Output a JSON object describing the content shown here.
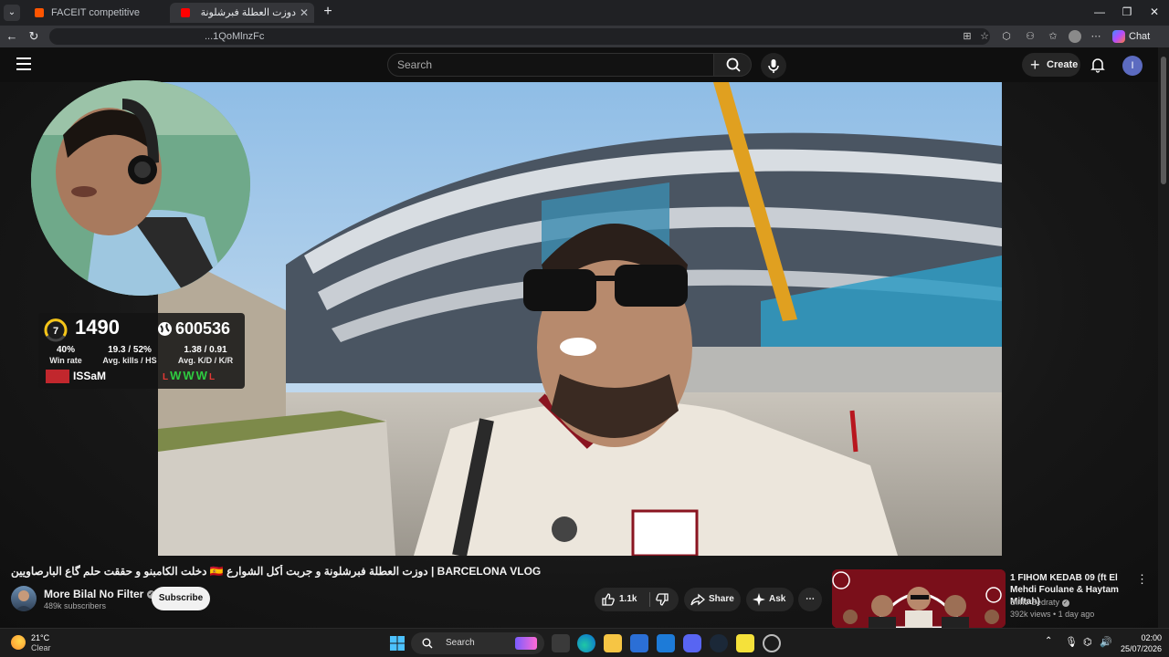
{
  "browser": {
    "tabs": [
      {
        "label": "FACEIT competitive"
      },
      {
        "label": "دوزت العطلة فبرشلونة و جربت أكل"
      }
    ],
    "url": "...1QoMlnzFc",
    "chat_label": "Chat"
  },
  "youtube": {
    "search_placeholder": "Search",
    "create_label": "Create",
    "account_initial": "I"
  },
  "faceit": {
    "level": "7",
    "elo": "1490",
    "matches": "600536",
    "stats": [
      {
        "value": "40%",
        "label": "Win rate"
      },
      {
        "value": "19.3 / 52%",
        "label": "Avg. kills / HS"
      },
      {
        "value": "1.38 / 0.91",
        "label": "Avg. K/D / K/R"
      }
    ],
    "nickname": "ISSaM",
    "results": [
      "L",
      "W",
      "W",
      "W",
      "L"
    ],
    "colors": {
      "win": "#2ecc40",
      "loss": "#e53935",
      "level": "#f5c518"
    }
  },
  "video": {
    "title": "دخلت الكامبنو و حققت حلم گاع البارصاويين 🇪🇸 دوزت العطلة فبرشلونة و جربت أكل الشوارع | BARCELONA VLOG",
    "channel": "More Bilal No Filter",
    "subscribers": "489k subscribers",
    "subscribe_label": "Subscribe",
    "likes": "1.1k",
    "share_label": "Share",
    "ask_label": "Ask"
  },
  "recommended": {
    "title": "1 FIHOM KEDAB 09 (ft El Mehdi Foulane & Haytam Miftah)",
    "channel": "Simo Sedraty",
    "meta": "392k views • 1 day ago"
  },
  "taskbar": {
    "temperature": "21°C",
    "condition": "Clear",
    "search_label": "Search",
    "time": "02:00",
    "date": "25/07/2026"
  }
}
